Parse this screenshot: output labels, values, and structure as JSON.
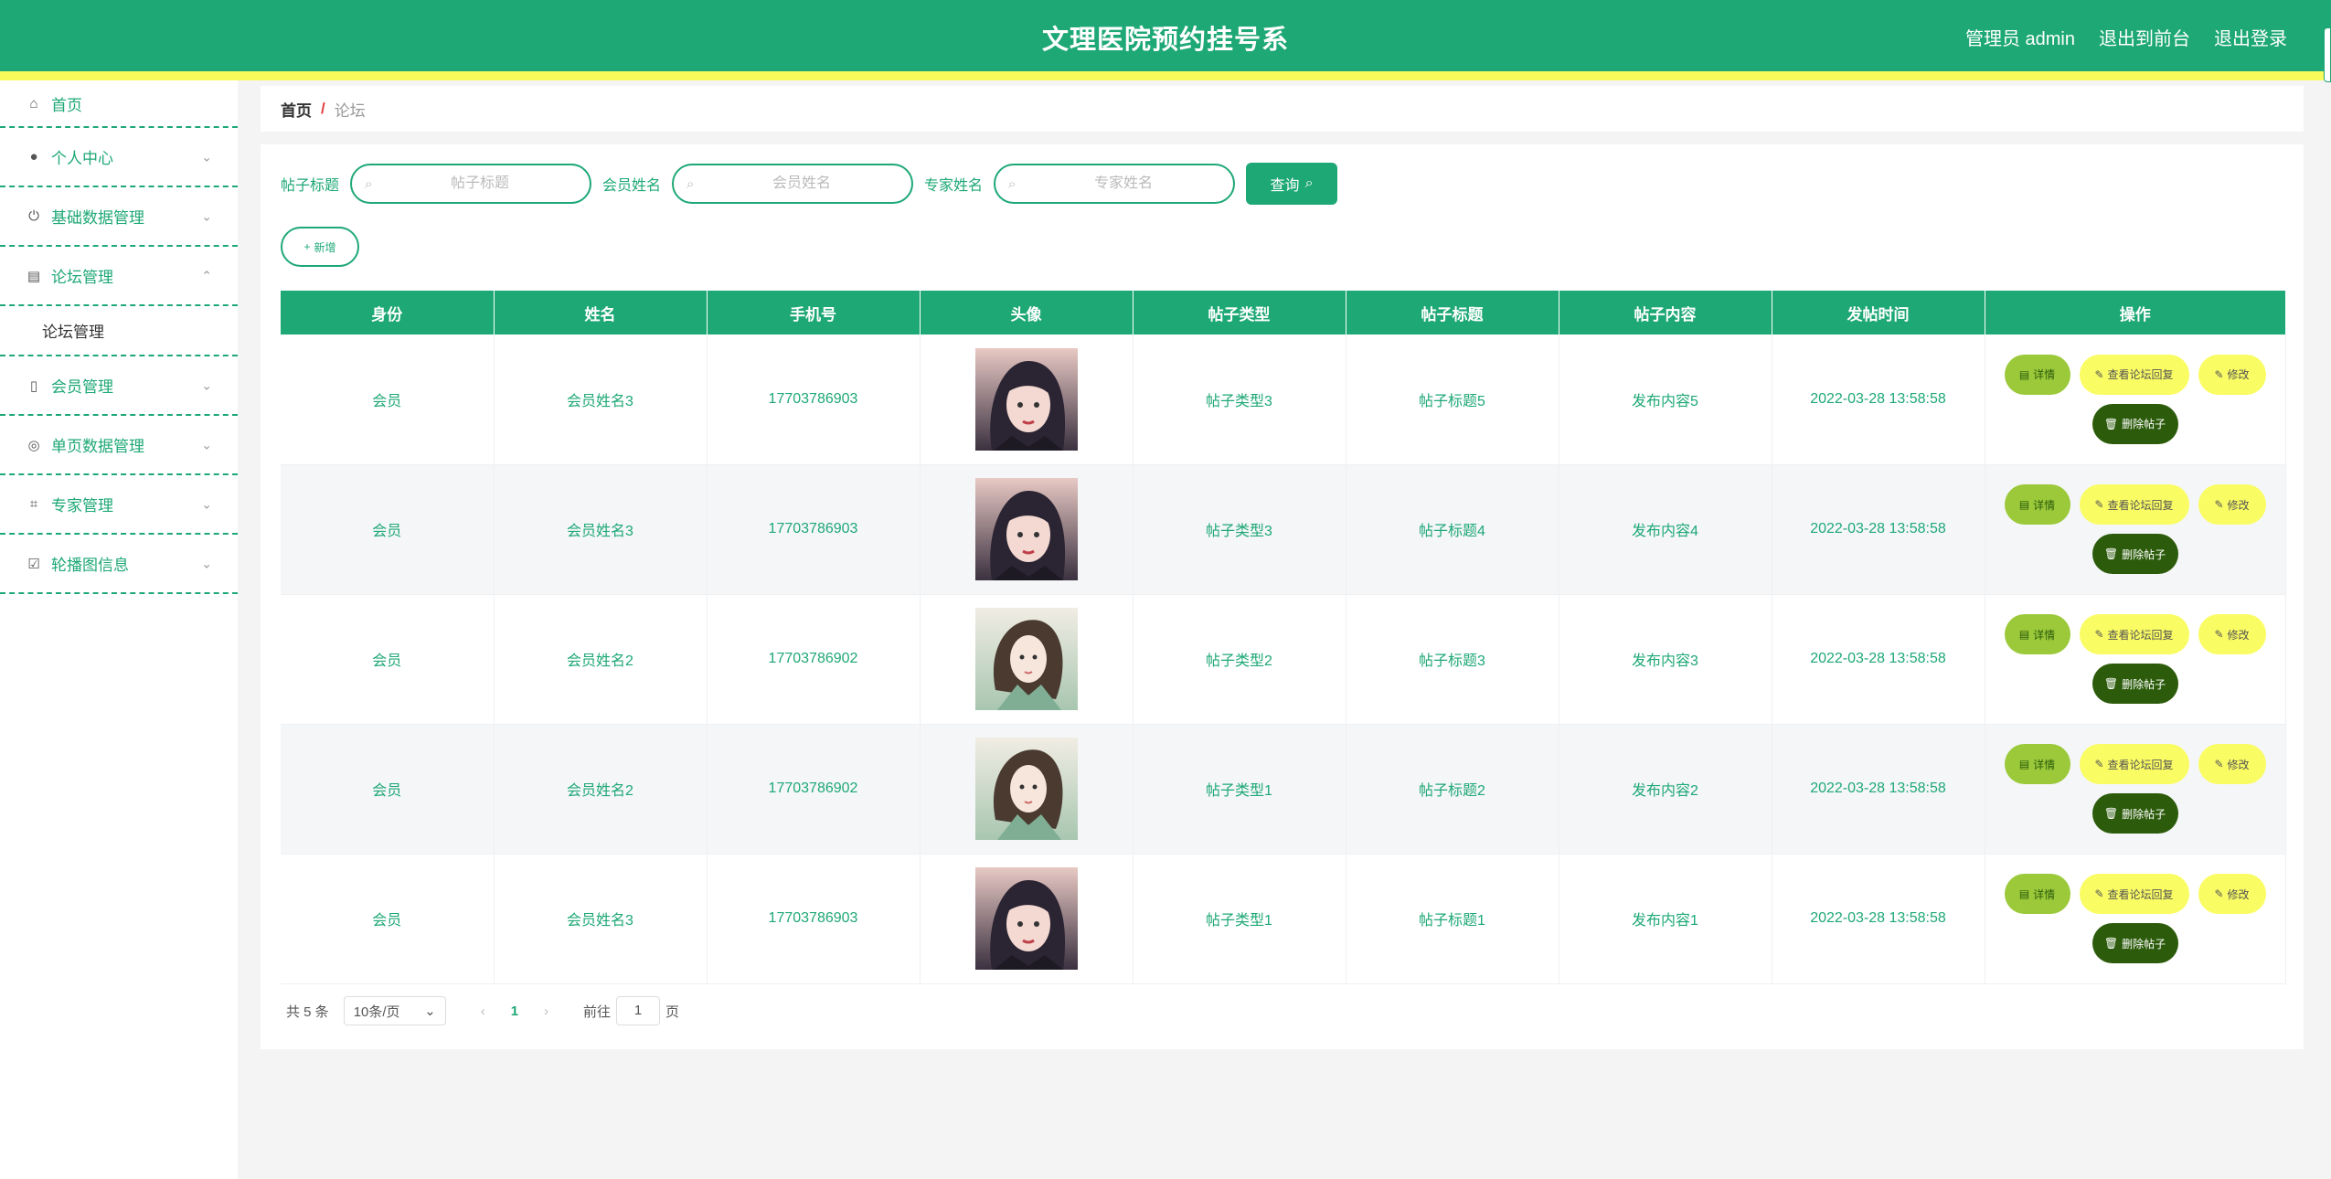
{
  "header": {
    "title": "文理医院预约挂号系",
    "admin_label": "管理员 admin",
    "to_frontend": "退出到前台",
    "logout": "退出登录"
  },
  "sidebar": {
    "items": [
      {
        "label": "首页",
        "icon": "home-icon"
      },
      {
        "label": "个人中心",
        "icon": "user-icon"
      },
      {
        "label": "基础数据管理",
        "icon": "power-icon"
      },
      {
        "label": "论坛管理",
        "icon": "clipboard-icon",
        "expanded": true
      },
      {
        "label": "会员管理",
        "icon": "phone-icon"
      },
      {
        "label": "单页数据管理",
        "icon": "compass-icon"
      },
      {
        "label": "专家管理",
        "icon": "crop-icon"
      },
      {
        "label": "轮播图信息",
        "icon": "checklist-icon"
      }
    ],
    "sub_item": "论坛管理"
  },
  "breadcrumb": {
    "home": "首页",
    "sep": "/",
    "current": "论坛"
  },
  "search": {
    "title_label": "帖子标题",
    "title_placeholder": "帖子标题",
    "member_label": "会员姓名",
    "member_placeholder": "会员姓名",
    "expert_label": "专家姓名",
    "expert_placeholder": "专家姓名",
    "query_btn": "查询"
  },
  "add_btn": "新增",
  "table": {
    "headers": [
      "身份",
      "姓名",
      "手机号",
      "头像",
      "帖子类型",
      "帖子标题",
      "帖子内容",
      "发帖时间",
      "操作"
    ],
    "rows": [
      {
        "role": "会员",
        "name": "会员姓名3",
        "phone": "17703786903",
        "avatar": "avatar-1",
        "type": "帖子类型3",
        "title": "帖子标题5",
        "content": "发布内容5",
        "time": "2022-03-28 13:58:58"
      },
      {
        "role": "会员",
        "name": "会员姓名3",
        "phone": "17703786903",
        "avatar": "avatar-1",
        "type": "帖子类型3",
        "title": "帖子标题4",
        "content": "发布内容4",
        "time": "2022-03-28 13:58:58"
      },
      {
        "role": "会员",
        "name": "会员姓名2",
        "phone": "17703786902",
        "avatar": "avatar-2",
        "type": "帖子类型2",
        "title": "帖子标题3",
        "content": "发布内容3",
        "time": "2022-03-28 13:58:58"
      },
      {
        "role": "会员",
        "name": "会员姓名2",
        "phone": "17703786902",
        "avatar": "avatar-2",
        "type": "帖子类型1",
        "title": "帖子标题2",
        "content": "发布内容2",
        "time": "2022-03-28 13:58:58"
      },
      {
        "role": "会员",
        "name": "会员姓名3",
        "phone": "17703786903",
        "avatar": "avatar-1",
        "type": "帖子类型1",
        "title": "帖子标题1",
        "content": "发布内容1",
        "time": "2022-03-28 13:58:58"
      }
    ],
    "ops": {
      "detail": "详情",
      "reply": "查看论坛回复",
      "edit": "修改",
      "delete": "删除帖子"
    }
  },
  "pagination": {
    "total": "共 5 条",
    "page_size": "10条/页",
    "current": "1",
    "goto_prefix": "前往",
    "goto_value": "1",
    "goto_suffix": "页"
  },
  "colors": {
    "primary": "#1ea876",
    "stripe": "#f8fb5a",
    "detail": "#9bc93a",
    "reply": "#fafc63",
    "delete": "#2c5c0b"
  }
}
